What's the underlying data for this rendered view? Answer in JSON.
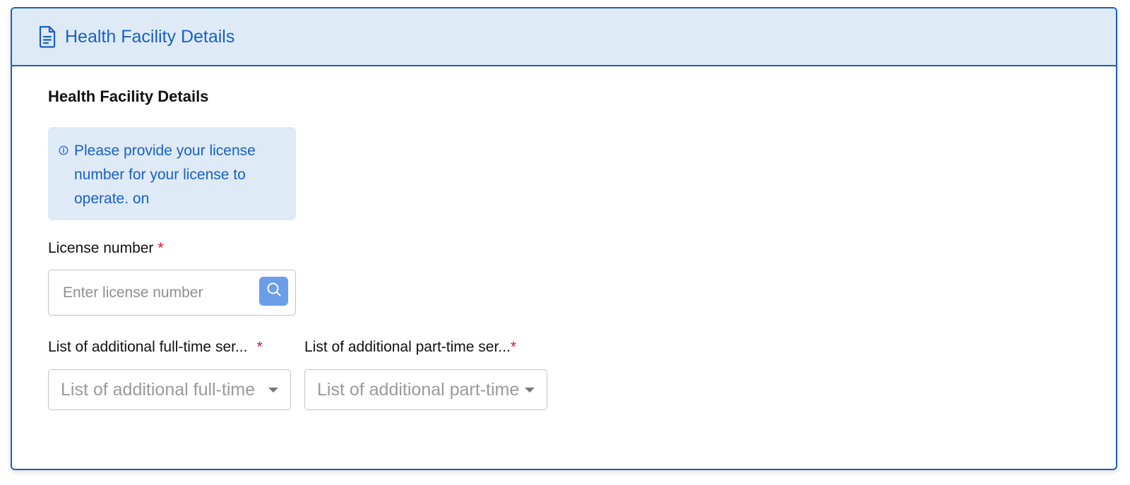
{
  "header": {
    "icon": "document-icon",
    "title": "Health Facility Details"
  },
  "section": {
    "title": "Health Facility Details"
  },
  "info": {
    "icon": "info-icon",
    "text": "Please provide your license number for your license to operate. on"
  },
  "license": {
    "label": "License number",
    "required_mark": "*",
    "placeholder": "Enter license number",
    "value": "",
    "button_icon": "search-icon"
  },
  "full_time": {
    "label": "List of additional full-time ser...",
    "required_mark": "*",
    "placeholder": "List of additional full-time"
  },
  "part_time": {
    "label": "List of additional part-time ser...",
    "required_mark": "*",
    "placeholder": "List of additional part-time"
  },
  "colors": {
    "accent": "#1a5fc4",
    "header_bg": "#deebf7",
    "required": "#e0102a",
    "search_button": "#6a9ee8"
  }
}
